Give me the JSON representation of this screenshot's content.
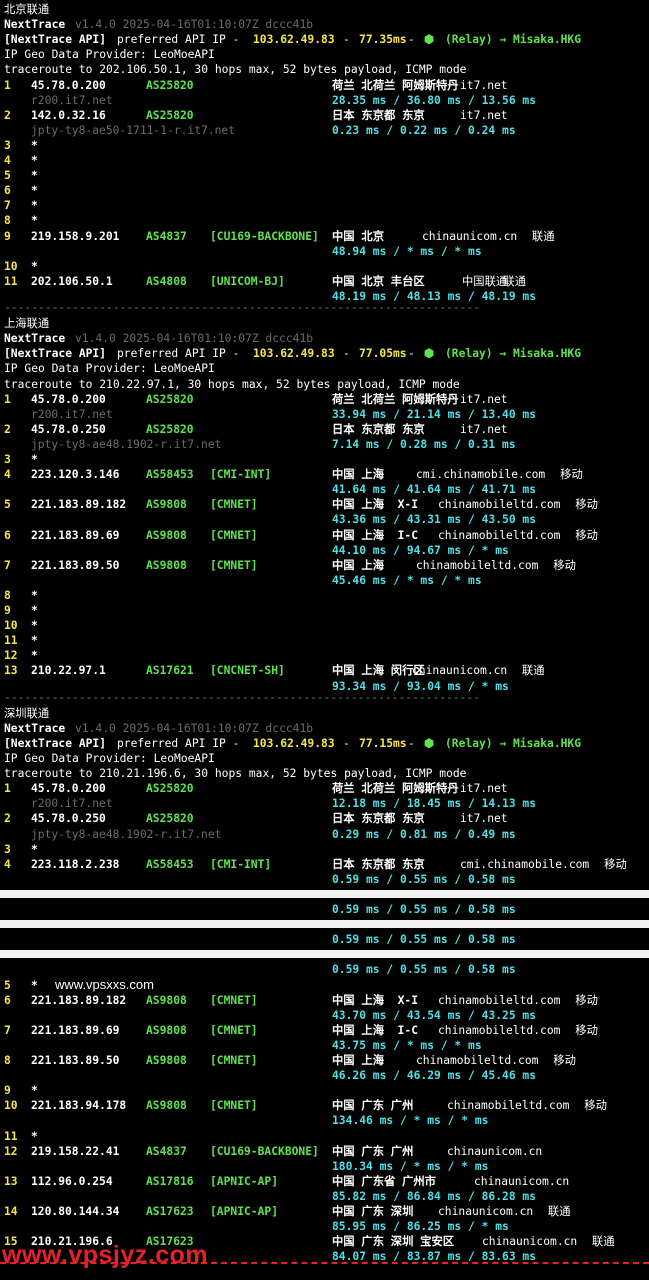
{
  "sections": {
    "beijing": {
      "title": "北京联通",
      "version_line": "v1.4.0 2025-04-16T01:10:07Z dccc41b",
      "api_latency": "77.35ms",
      "traceroute": "traceroute to 202.106.50.1, 30 hops max, 52 bytes payload, ICMP mode",
      "hops": [
        {
          "n": "1",
          "ip": "45.78.0.200",
          "as": "AS25820",
          "tag": "",
          "geo": "荷兰 北荷兰 阿姆斯特丹",
          "org": "it7.net",
          "isp": "",
          "host": "r200.it7.net",
          "rtt": "28.35 ms / 36.80 ms / 13.56 ms"
        },
        {
          "n": "2",
          "ip": "142.0.32.16",
          "as": "AS25820",
          "tag": "",
          "geo": "日本 东京都 东京",
          "org": "it7.net",
          "isp": "",
          "host": "jpty-ty8-ae50-1711-1-r.it7.net",
          "rtt": "0.23 ms / 0.22 ms / 0.24 ms"
        },
        {
          "n": "3",
          "star": "*"
        },
        {
          "n": "4",
          "star": "*"
        },
        {
          "n": "5",
          "star": "*"
        },
        {
          "n": "6",
          "star": "*"
        },
        {
          "n": "7",
          "star": "*"
        },
        {
          "n": "8",
          "star": "*"
        },
        {
          "n": "9",
          "ip": "219.158.9.201",
          "as": "AS4837",
          "tag": "[CU169-BACKBONE]",
          "geo": "中国 北京",
          "org": "chinaunicom.cn",
          "isp": "联通",
          "rtt": "48.94 ms / * ms / * ms"
        },
        {
          "n": "10",
          "star": "*"
        },
        {
          "n": "11",
          "ip": "202.106.50.1",
          "as": "AS4808",
          "tag": "[UNICOM-BJ]",
          "geo": "中国 北京 丰台区",
          "org": "中国联通",
          "isp": "联通",
          "rtt": "48.19 ms / 48.13 ms / 48.19 ms"
        }
      ]
    },
    "shanghai": {
      "title": "上海联通",
      "version_line": "v1.4.0 2025-04-16T01:10:07Z dccc41b",
      "api_latency": "77.05ms",
      "traceroute": "traceroute to 210.22.97.1, 30 hops max, 52 bytes payload, ICMP mode",
      "hops": [
        {
          "n": "1",
          "ip": "45.78.0.200",
          "as": "AS25820",
          "tag": "",
          "geo": "荷兰 北荷兰 阿姆斯特丹",
          "org": "it7.net",
          "isp": "",
          "host": "r200.it7.net",
          "rtt": "33.94 ms / 21.14 ms / 13.40 ms"
        },
        {
          "n": "2",
          "ip": "45.78.0.250",
          "as": "AS25820",
          "tag": "",
          "geo": "日本 东京都 东京",
          "org": "it7.net",
          "isp": "",
          "host": "jpty-ty8-ae48.1902-r.it7.net",
          "rtt": "7.14 ms / 0.28 ms / 0.31 ms"
        },
        {
          "n": "3",
          "star": "*"
        },
        {
          "n": "4",
          "ip": "223.120.3.146",
          "as": "AS58453",
          "tag": "[CMI-INT]",
          "geo": "中国 上海",
          "org": "cmi.chinamobile.com",
          "isp": "移动",
          "rtt": "41.64 ms / 41.64 ms / 41.71 ms"
        },
        {
          "n": "5",
          "ip": "221.183.89.182",
          "as": "AS9808",
          "tag": "[CMNET]",
          "geo": "中国 上海  X-I",
          "org": "chinamobileltd.com",
          "isp": "移动",
          "rtt": "43.36 ms / 43.31 ms / 43.50 ms"
        },
        {
          "n": "6",
          "ip": "221.183.89.69",
          "as": "AS9808",
          "tag": "[CMNET]",
          "geo": "中国 上海  I-C",
          "org": "chinamobileltd.com",
          "isp": "移动",
          "rtt": "44.10 ms / 94.67 ms / * ms"
        },
        {
          "n": "7",
          "ip": "221.183.89.50",
          "as": "AS9808",
          "tag": "[CMNET]",
          "geo": "中国 上海",
          "org": "chinamobileltd.com",
          "isp": "移动",
          "rtt": "45.46 ms / * ms / * ms"
        },
        {
          "n": "8",
          "star": "*"
        },
        {
          "n": "9",
          "star": "*"
        },
        {
          "n": "10",
          "star": "*"
        },
        {
          "n": "11",
          "star": "*"
        },
        {
          "n": "12",
          "star": "*"
        },
        {
          "n": "13",
          "ip": "210.22.97.1",
          "as": "AS17621",
          "tag": "[CNCNET-SH]",
          "geo": "中国 上海 闵行区",
          "org": "chinaunicom.cn",
          "isp": "联通",
          "rtt": "93.34 ms / 93.04 ms / * ms"
        }
      ]
    },
    "shenzhen": {
      "title": "深圳联通",
      "version_line": "v1.4.0 2025-04-16T01:10:07Z dccc41b",
      "api_latency": "77.15ms",
      "traceroute": "traceroute to 210.21.196.6, 30 hops max, 52 bytes payload, ICMP mode",
      "hops": [
        {
          "n": "1",
          "ip": "45.78.0.200",
          "as": "AS25820",
          "tag": "",
          "geo": "荷兰 北荷兰 阿姆斯特丹",
          "org": "it7.net",
          "isp": "",
          "host": "r200.it7.net",
          "rtt": "12.18 ms / 18.45 ms / 14.13 ms"
        },
        {
          "n": "2",
          "ip": "45.78.0.250",
          "as": "AS25820",
          "tag": "",
          "geo": "日本 东京都 东京",
          "org": "it7.net",
          "isp": "",
          "host": "jpty-ty8-ae48.1902-r.it7.net",
          "rtt": "0.29 ms / 0.81 ms / 0.49 ms"
        },
        {
          "n": "3",
          "star": "*"
        },
        {
          "n": "4",
          "ip": "223.118.2.238",
          "as": "AS58453",
          "tag": "[CMI-INT]",
          "geo": "日本 东京都 东京",
          "org": "cmi.chinamobile.com",
          "isp": "移动",
          "rtt": "0.59 ms / 0.55 ms / 0.58 ms"
        },
        {
          "n": "",
          "masked": true,
          "rtt": "0.59 ms / 0.55 ms / 0.58 ms"
        },
        {
          "n": "",
          "masked": true,
          "rtt": "0.59 ms / 0.55 ms / 0.58 ms"
        },
        {
          "n": "",
          "masked": true,
          "rtt": "0.59 ms / 0.55 ms / 0.58 ms"
        },
        {
          "n": "5",
          "star": "*"
        },
        {
          "n": "6",
          "ip": "221.183.89.182",
          "as": "AS9808",
          "tag": "[CMNET]",
          "geo": "中国 上海  X-I",
          "org": "chinamobileltd.com",
          "isp": "移动",
          "rtt": "43.70 ms / 43.54 ms / 43.25 ms"
        },
        {
          "n": "7",
          "ip": "221.183.89.69",
          "as": "AS9808",
          "tag": "[CMNET]",
          "geo": "中国 上海  I-C",
          "org": "chinamobileltd.com",
          "isp": "移动",
          "rtt": "43.75 ms / * ms / * ms"
        },
        {
          "n": "8",
          "ip": "221.183.89.50",
          "as": "AS9808",
          "tag": "[CMNET]",
          "geo": "中国 上海",
          "org": "chinamobileltd.com",
          "isp": "移动",
          "rtt": "46.26 ms / 46.29 ms / 45.46 ms"
        },
        {
          "n": "9",
          "star": "*"
        },
        {
          "n": "10",
          "ip": "221.183.94.178",
          "as": "AS9808",
          "tag": "[CMNET]",
          "geo": "中国 广东 广州",
          "org": "chinamobileltd.com",
          "isp": "移动",
          "rtt": "134.46 ms / * ms / * ms"
        },
        {
          "n": "11",
          "star": "*"
        },
        {
          "n": "12",
          "ip": "219.158.22.41",
          "as": "AS4837",
          "tag": "[CU169-BACKBONE]",
          "geo": "中国 广东 广州",
          "org": "chinaunicom.cn",
          "isp": "",
          "rtt": "180.34 ms / * ms / * ms"
        },
        {
          "n": "13",
          "ip": "112.96.0.254",
          "as": "AS17816",
          "tag": "[APNIC-AP]",
          "geo": "中国 广东省 广州市",
          "org": "chinaunicom.cn",
          "isp": "",
          "rtt": "85.82 ms / 86.84 ms / 86.28 ms"
        },
        {
          "n": "14",
          "ip": "120.80.144.34",
          "as": "AS17623",
          "tag": "[APNIC-AP]",
          "geo": "中国 广东 深圳",
          "org": "chinaunicom.cn",
          "isp": "联通",
          "rtt": "85.95 ms / 86.25 ms / * ms"
        },
        {
          "n": "15",
          "ip": "210.21.196.6",
          "as": "AS17623",
          "tag": "",
          "geo": "中国 广东 深圳 宝安区",
          "org": "chinaunicom.cn",
          "isp": "联通",
          "rtt": "84.07 ms / 83.87 ms / 83.63 ms"
        }
      ]
    }
  },
  "common": {
    "app_name": "NextTrace",
    "api_label": "[NextTrace API]",
    "api_text": "preferred API IP -",
    "api_ip": "103.62.49.83",
    "relay": "(Relay) → Misaka.HKG",
    "geo_provider": "IP Geo Data Provider: LeoMoeAPI",
    "separator": "----------------------------------------------------------------------"
  },
  "watermarks": {
    "top": "www.vpsxxs.com",
    "bottom": "www.vpsjyz.com"
  },
  "colors": {
    "hop_number": "#f4e64a",
    "asn": "#5fe34d",
    "rtt": "#4ee0e8",
    "hostname": "#6b6b6b",
    "watermark_bottom": "#e8202a"
  }
}
